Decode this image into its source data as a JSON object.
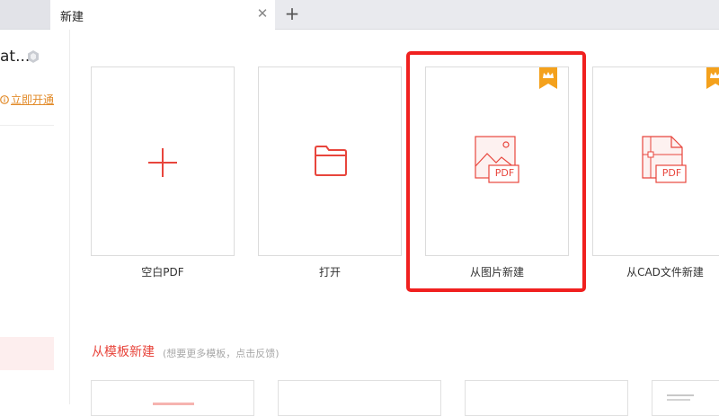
{
  "tabs": {
    "active_label": "新建",
    "close_glyph": "✕",
    "add_glyph": "+"
  },
  "sidebar": {
    "user_name": "at...",
    "vip_link_icon": "info-icon",
    "vip_link_label": "立即开通"
  },
  "cards": [
    {
      "label": "空白PDF",
      "icon": "plus-icon"
    },
    {
      "label": "打开",
      "icon": "folder-icon"
    },
    {
      "label": "从图片新建",
      "icon": "image-pdf-icon",
      "badge_text": "PDF",
      "premium": true
    },
    {
      "label": "从CAD文件新建",
      "icon": "cad-pdf-icon",
      "badge_text": "PDF",
      "premium": true
    }
  ],
  "templates": {
    "title": "从模板新建",
    "hint": "(想要更多模板，点击反馈)"
  },
  "colors": {
    "accent": "#e8453c",
    "highlight": "#f0201f",
    "crown": "#f4a11c",
    "link": "#e28b2a"
  }
}
